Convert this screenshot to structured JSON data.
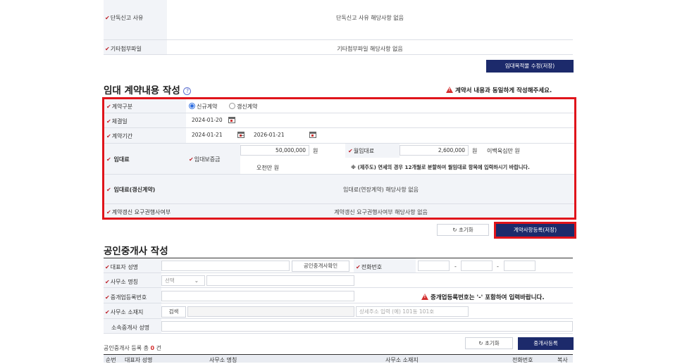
{
  "top": {
    "row1_label": "단독신고 사유",
    "row1_value": "단독신고 사유 해당사항 없음",
    "row2_label": "기타첨부파일",
    "row2_value": "기타첨부파일 해당사항 없음",
    "edit_button": "임대목적물 수정(저장)"
  },
  "contract": {
    "title": "임대 계약내용 작성",
    "help_icon": "?",
    "warning": "계약서 내용과 동일하게 작성해주세요.",
    "type_label": "계약구분",
    "type_options": [
      "신규계약",
      "갱신계약"
    ],
    "signed_label": "체결일",
    "signed_value": "2024-01-20",
    "period_label": "계약기간",
    "period_start": "2024-01-21",
    "period_sep": "~",
    "period_end": "2026-01-21",
    "rent_label": "임대료",
    "deposit_label": "임대보증금",
    "deposit_value": "50,000,000",
    "deposit_unit": "원",
    "deposit_korean": "오천만 원",
    "monthly_label": "월임대료",
    "monthly_value": "2,600,000",
    "monthly_unit": "원",
    "monthly_korean": "이백육십만 원",
    "jeju_note": "※ (제주도) 연세의 경우 12개월로 분할하여 월임대료 항목에 입력하시기 바랍니다.",
    "renew_rent_label": "임대료(갱신계약)",
    "renew_rent_value": "임대료(연장계약) 해당사항 없음",
    "renew_req_label": "계약갱신 요구권행사여부",
    "renew_req_value": "계약갱신 요구권행사여부 해당사항 없음",
    "reset_button": "초기화",
    "register_button": "계약사항등록(저장)"
  },
  "agent": {
    "title": "공인중개사 작성",
    "rep_label": "대표자 성명",
    "verify_button": "공인중개사확인",
    "phone_label": "전화번호",
    "phone_sep": "-",
    "office_label": "사무소 명칭",
    "office_select": "선택",
    "reg_label": "중개업등록번호",
    "reg_warning": "중개업등록번호는 '-' 포함하여 입력바랍니다.",
    "addr_label": "사무소 소재지",
    "search_button": "검색",
    "addr_detail_placeholder": "상세주소 입력 (예) 101동 101호",
    "member_label": "소속중개사 성명",
    "count_prefix": "공인중개사 등록 총",
    "count_value": "0",
    "count_suffix": "건",
    "reset_button": "초기화",
    "register_button": "중개사등록",
    "table_headers": [
      "순번",
      "대표자 성명",
      "사무소 명칭",
      "사무소 소재지",
      "전화번호",
      "복사"
    ]
  }
}
